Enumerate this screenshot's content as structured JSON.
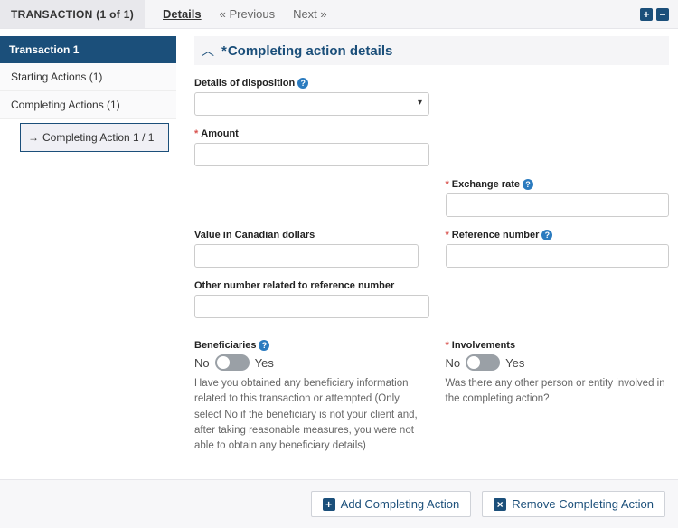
{
  "topbar": {
    "title": "TRANSACTION (1 of 1)",
    "details": "Details",
    "prev": "Previous",
    "next": "Next"
  },
  "sidebar": {
    "heading": "Transaction 1",
    "starting": "Starting Actions (1)",
    "completing": "Completing Actions (1)",
    "sub": "Completing Action 1 / 1"
  },
  "section": {
    "title": "Completing action details"
  },
  "fields": {
    "disposition": "Details of disposition",
    "amount": "Amount",
    "exchange": "Exchange rate",
    "valuecad": "Value in Canadian dollars",
    "refnum": "Reference number",
    "othernum": "Other number related to reference number"
  },
  "beneficiaries": {
    "label": "Beneficiaries",
    "no": "No",
    "yes": "Yes",
    "helper": "Have you obtained any beneficiary information related to this transaction or attempted (Only select No if the beneficiary is not your client and, after taking reasonable measures, you were not able to obtain any beneficiary details)"
  },
  "involvements": {
    "label": "Involvements",
    "no": "No",
    "yes": "Yes",
    "helper": "Was there any other person or entity involved in the completing action?"
  },
  "footer": {
    "add": "Add Completing Action",
    "remove": "Remove Completing Action"
  }
}
